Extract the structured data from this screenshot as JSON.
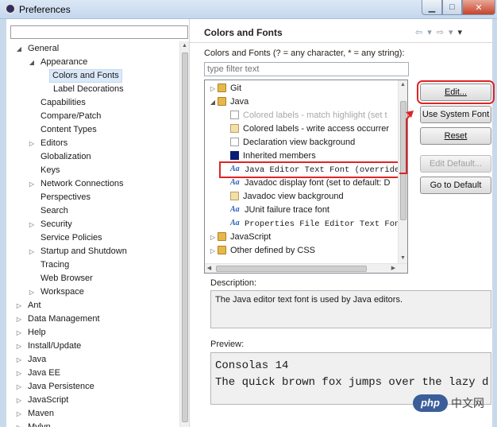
{
  "window": {
    "title": "Preferences",
    "minimize_glyph": "▁",
    "maximize_glyph": "□",
    "close_glyph": "✕"
  },
  "left_tree": {
    "filter_value": "",
    "items": [
      {
        "label": "General",
        "indent": 0,
        "arrow": "◢",
        "selected": false
      },
      {
        "label": "Appearance",
        "indent": 1,
        "arrow": "◢",
        "selected": false
      },
      {
        "label": "Colors and Fonts",
        "indent": 2,
        "arrow": "",
        "selected": true
      },
      {
        "label": "Label Decorations",
        "indent": 2,
        "arrow": "",
        "selected": false
      },
      {
        "label": "Capabilities",
        "indent": 1,
        "arrow": "",
        "selected": false
      },
      {
        "label": "Compare/Patch",
        "indent": 1,
        "arrow": "",
        "selected": false
      },
      {
        "label": "Content Types",
        "indent": 1,
        "arrow": "",
        "selected": false
      },
      {
        "label": "Editors",
        "indent": 1,
        "arrow": "▷",
        "selected": false
      },
      {
        "label": "Globalization",
        "indent": 1,
        "arrow": "",
        "selected": false
      },
      {
        "label": "Keys",
        "indent": 1,
        "arrow": "",
        "selected": false
      },
      {
        "label": "Network Connections",
        "indent": 1,
        "arrow": "▷",
        "selected": false
      },
      {
        "label": "Perspectives",
        "indent": 1,
        "arrow": "",
        "selected": false
      },
      {
        "label": "Search",
        "indent": 1,
        "arrow": "",
        "selected": false
      },
      {
        "label": "Security",
        "indent": 1,
        "arrow": "▷",
        "selected": false
      },
      {
        "label": "Service Policies",
        "indent": 1,
        "arrow": "",
        "selected": false
      },
      {
        "label": "Startup and Shutdown",
        "indent": 1,
        "arrow": "▷",
        "selected": false
      },
      {
        "label": "Tracing",
        "indent": 1,
        "arrow": "",
        "selected": false
      },
      {
        "label": "Web Browser",
        "indent": 1,
        "arrow": "",
        "selected": false
      },
      {
        "label": "Workspace",
        "indent": 1,
        "arrow": "▷",
        "selected": false
      },
      {
        "label": "Ant",
        "indent": 0,
        "arrow": "▷",
        "selected": false
      },
      {
        "label": "Data Management",
        "indent": 0,
        "arrow": "▷",
        "selected": false
      },
      {
        "label": "Help",
        "indent": 0,
        "arrow": "▷",
        "selected": false
      },
      {
        "label": "Install/Update",
        "indent": 0,
        "arrow": "▷",
        "selected": false
      },
      {
        "label": "Java",
        "indent": 0,
        "arrow": "▷",
        "selected": false
      },
      {
        "label": "Java EE",
        "indent": 0,
        "arrow": "▷",
        "selected": false
      },
      {
        "label": "Java Persistence",
        "indent": 0,
        "arrow": "▷",
        "selected": false
      },
      {
        "label": "JavaScript",
        "indent": 0,
        "arrow": "▷",
        "selected": false
      },
      {
        "label": "Maven",
        "indent": 0,
        "arrow": "▷",
        "selected": false
      },
      {
        "label": "Mylyn",
        "indent": 0,
        "arrow": "▷",
        "selected": false
      }
    ]
  },
  "page": {
    "title": "Colors and Fonts",
    "colors_label": "Colors and Fonts (? = any character, * = any string):",
    "filter_placeholder": "type filter text"
  },
  "cf_tree": [
    {
      "label": "Git",
      "indent": 0,
      "arrow": "▷",
      "icon": "folder",
      "style": "",
      "muted": false,
      "highlighted": false
    },
    {
      "label": "Java",
      "indent": 0,
      "arrow": "◢",
      "icon": "folder",
      "style": "",
      "muted": false,
      "highlighted": false
    },
    {
      "label": "Colored labels - match highlight (set t",
      "indent": 1,
      "arrow": "",
      "icon": "white",
      "style": "",
      "muted": true,
      "highlighted": false
    },
    {
      "label": "Colored labels - write access occurrer",
      "indent": 1,
      "arrow": "",
      "icon": "tan",
      "style": "",
      "muted": false,
      "highlighted": false
    },
    {
      "label": "Declaration view background",
      "indent": 1,
      "arrow": "",
      "icon": "white",
      "style": "",
      "muted": false,
      "highlighted": false
    },
    {
      "label": "Inherited members",
      "indent": 1,
      "arrow": "",
      "icon": "navy",
      "style": "",
      "muted": false,
      "highlighted": false
    },
    {
      "label": "Java Editor Text Font (overrides",
      "indent": 1,
      "arrow": "",
      "icon": "font",
      "style": "mono",
      "muted": false,
      "highlighted": true
    },
    {
      "label": "Javadoc display font (set to default: D",
      "indent": 1,
      "arrow": "",
      "icon": "font",
      "style": "",
      "muted": false,
      "highlighted": false
    },
    {
      "label": "Javadoc view background",
      "indent": 1,
      "arrow": "",
      "icon": "tan",
      "style": "",
      "muted": false,
      "highlighted": false
    },
    {
      "label": "JUnit failure trace font",
      "indent": 1,
      "arrow": "",
      "icon": "font",
      "style": "",
      "muted": false,
      "highlighted": false
    },
    {
      "label": "Properties File Editor Text Font",
      "indent": 1,
      "arrow": "",
      "icon": "font",
      "style": "mono",
      "muted": false,
      "highlighted": false
    },
    {
      "label": "JavaScript",
      "indent": 0,
      "arrow": "▷",
      "icon": "folder",
      "style": "",
      "muted": false,
      "highlighted": false
    },
    {
      "label": "Other defined by CSS",
      "indent": 0,
      "arrow": "▷",
      "icon": "folder",
      "style": "",
      "muted": false,
      "highlighted": false
    }
  ],
  "font_icon_glyph": "Aa",
  "buttons": {
    "edit": {
      "label": "Edit...",
      "mnemonic": "E",
      "enabled": true
    },
    "use_system_font": {
      "label": "Use System Font",
      "mnemonic": "U",
      "enabled": true
    },
    "reset": {
      "label": "Reset",
      "mnemonic": "R",
      "enabled": true
    },
    "edit_default": {
      "label": "Edit Default...",
      "mnemonic": "",
      "enabled": false
    },
    "go_to_default": {
      "label": "Go to Default",
      "mnemonic": "G",
      "enabled": true
    }
  },
  "description": {
    "label": "Description:",
    "text": "The Java editor text font is used by Java editors."
  },
  "preview": {
    "label": "Preview:",
    "lines": [
      "Consolas 14",
      "The quick brown fox jumps over the lazy d"
    ]
  },
  "watermark": {
    "logo": "php",
    "text": "中文网"
  },
  "colors": {
    "annotation_red": "#e02424",
    "selection_blue": "#dbe9f9"
  }
}
